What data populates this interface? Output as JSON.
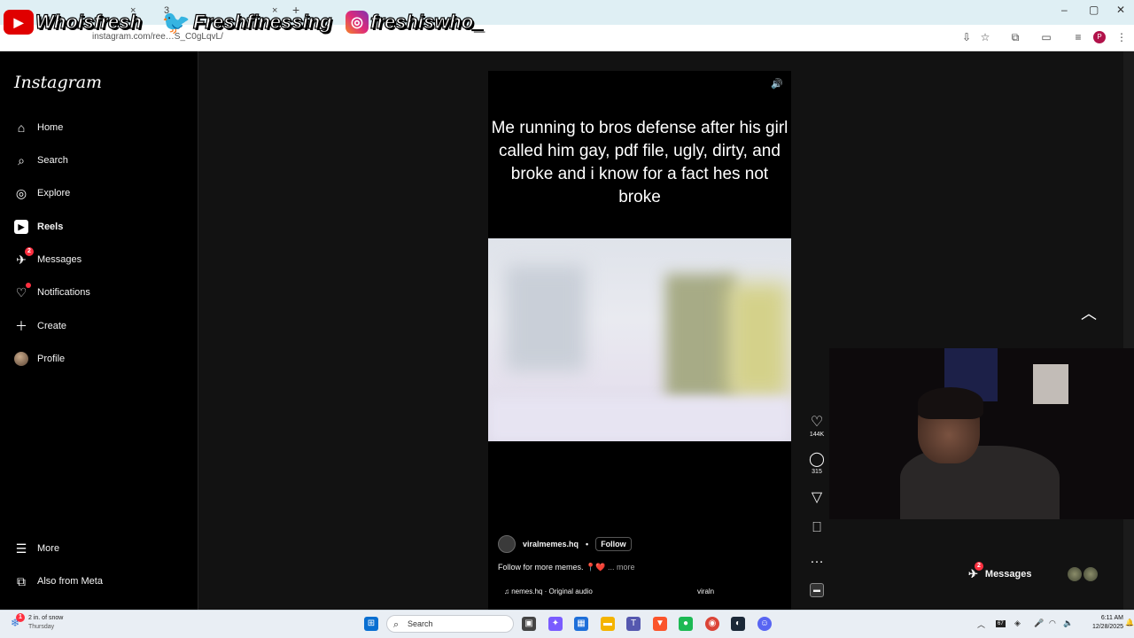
{
  "browser": {
    "tab_fragment": "3",
    "url": "instagram.com/ree…S_C0gLqvL/",
    "new_tab_symbol": "+",
    "close_symbol": "×"
  },
  "overlay": {
    "youtube_handle": "Whoisfresh",
    "twitter_handle": "Freshfinessing",
    "instagram_handle": "freshiswho_"
  },
  "sidebar": {
    "logo": "Instagram",
    "items": [
      {
        "label": "Home",
        "icon": "home-icon"
      },
      {
        "label": "Search",
        "icon": "search-icon"
      },
      {
        "label": "Explore",
        "icon": "compass-icon"
      },
      {
        "label": "Reels",
        "icon": "reels-icon"
      },
      {
        "label": "Messages",
        "icon": "messenger-icon",
        "badge": "2"
      },
      {
        "label": "Notifications",
        "icon": "heart-icon"
      },
      {
        "label": "Create",
        "icon": "plus-icon"
      },
      {
        "label": "Profile",
        "icon": "avatar"
      }
    ],
    "more": "More",
    "also_from_meta": "Also from Meta"
  },
  "reel": {
    "overlay_text": "Me running to bros defense after his girl called him gay, pdf file, ugly, dirty, and broke and i know for a fact hes not broke",
    "likes": "144K",
    "comments": "315",
    "username": "viralmemes.hq",
    "separator": "•",
    "follow": "Follow",
    "caption": "Follow for more memes. 📍❤️",
    "more": "... more",
    "audio": "♫ nemes.hq · Original audio",
    "tagged": "viraln"
  },
  "messages_pill": {
    "label": "Messages",
    "badge": "2"
  },
  "taskbar": {
    "weather_badge": "1",
    "weather_line1": "2 in. of snow",
    "weather_line2": "Thursday",
    "search_placeholder": "Search",
    "time": "6:11 AM",
    "date": "12/28/2025",
    "tray_badge": "67"
  },
  "colors": {
    "accent_red": "#ff3040",
    "background": "#121212",
    "chrome_bar": "#dfeff4"
  }
}
